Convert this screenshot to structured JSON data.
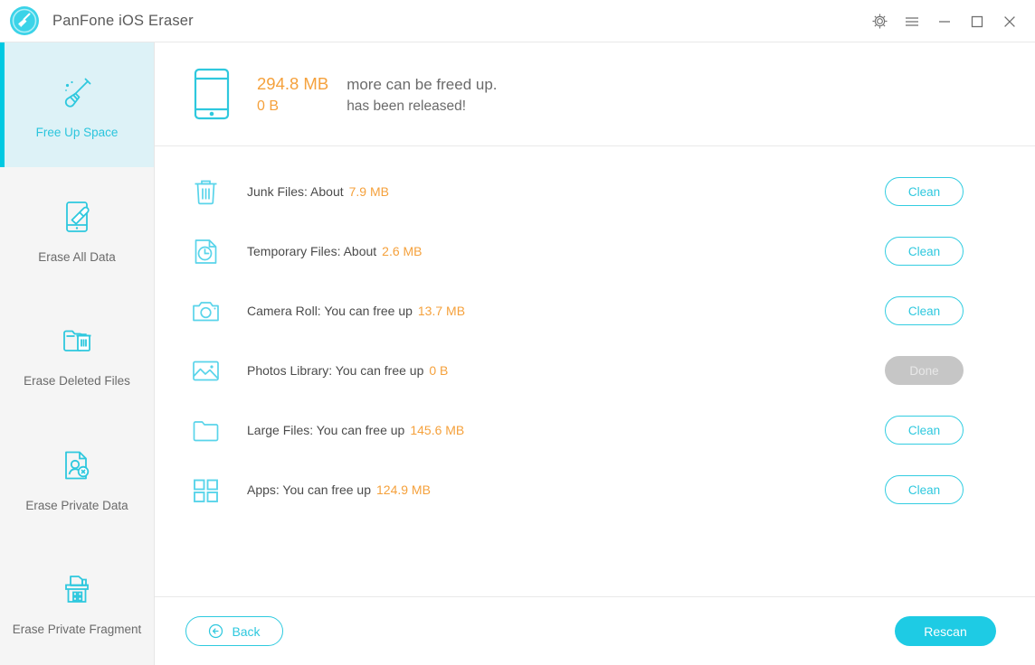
{
  "window": {
    "title": "PanFone iOS Eraser",
    "logo_icon": "broom-circle-logo",
    "controls": [
      {
        "name": "settings-button",
        "icon": "gear-icon"
      },
      {
        "name": "menu-button",
        "icon": "hamburger-menu-icon"
      },
      {
        "name": "minimize-button",
        "icon": "minimize-icon"
      },
      {
        "name": "maximize-button",
        "icon": "maximize-icon"
      },
      {
        "name": "close-button",
        "icon": "close-icon"
      }
    ]
  },
  "colors": {
    "accent_cyan": "#1ecbe4",
    "accent_cyan_dark": "#00c9e2",
    "active_bg": "#ddf2f7",
    "amount_orange": "#f5a13c",
    "text_gray": "#4b4b4b",
    "disabled_gray": "#c6c6c6"
  },
  "sidebar": {
    "items": [
      {
        "label": "Free Up Space",
        "icon": "broom-icon",
        "active": true
      },
      {
        "label": "Erase All Data",
        "icon": "phone-eraser-icon",
        "active": false
      },
      {
        "label": "Erase Deleted Files",
        "icon": "folder-trash-icon",
        "active": false
      },
      {
        "label": "Erase Private Data",
        "icon": "document-user-remove-icon",
        "active": false
      },
      {
        "label": "Erase Private Fragment",
        "icon": "file-cabinet-icon",
        "active": false
      }
    ]
  },
  "summary": {
    "device_icon": "smartphone-icon",
    "freeable_value": "294.8 MB",
    "freeable_message": "more can be freed up.",
    "released_value": "0 B",
    "released_message": "has been released!"
  },
  "items": [
    {
      "icon": "trash-icon",
      "label": "Junk Files: About",
      "amount": "7.9 MB",
      "action": "Clean",
      "done": false
    },
    {
      "icon": "clock-file-icon",
      "label": "Temporary Files: About",
      "amount": "2.6 MB",
      "action": "Clean",
      "done": false
    },
    {
      "icon": "camera-icon",
      "label": "Camera Roll: You can free up",
      "amount": "13.7 MB",
      "action": "Clean",
      "done": false
    },
    {
      "icon": "image-icon",
      "label": "Photos Library: You can free up",
      "amount": "0 B",
      "action": "Done",
      "done": true
    },
    {
      "icon": "folder-icon",
      "label": "Large Files: You can free up",
      "amount": "145.6 MB",
      "action": "Clean",
      "done": false
    },
    {
      "icon": "apps-grid-icon",
      "label": "Apps: You can free up",
      "amount": "124.9 MB",
      "action": "Clean",
      "done": false
    }
  ],
  "footer": {
    "back_label": "Back",
    "back_icon": "arrow-left-circle-icon",
    "rescan_label": "Rescan"
  }
}
